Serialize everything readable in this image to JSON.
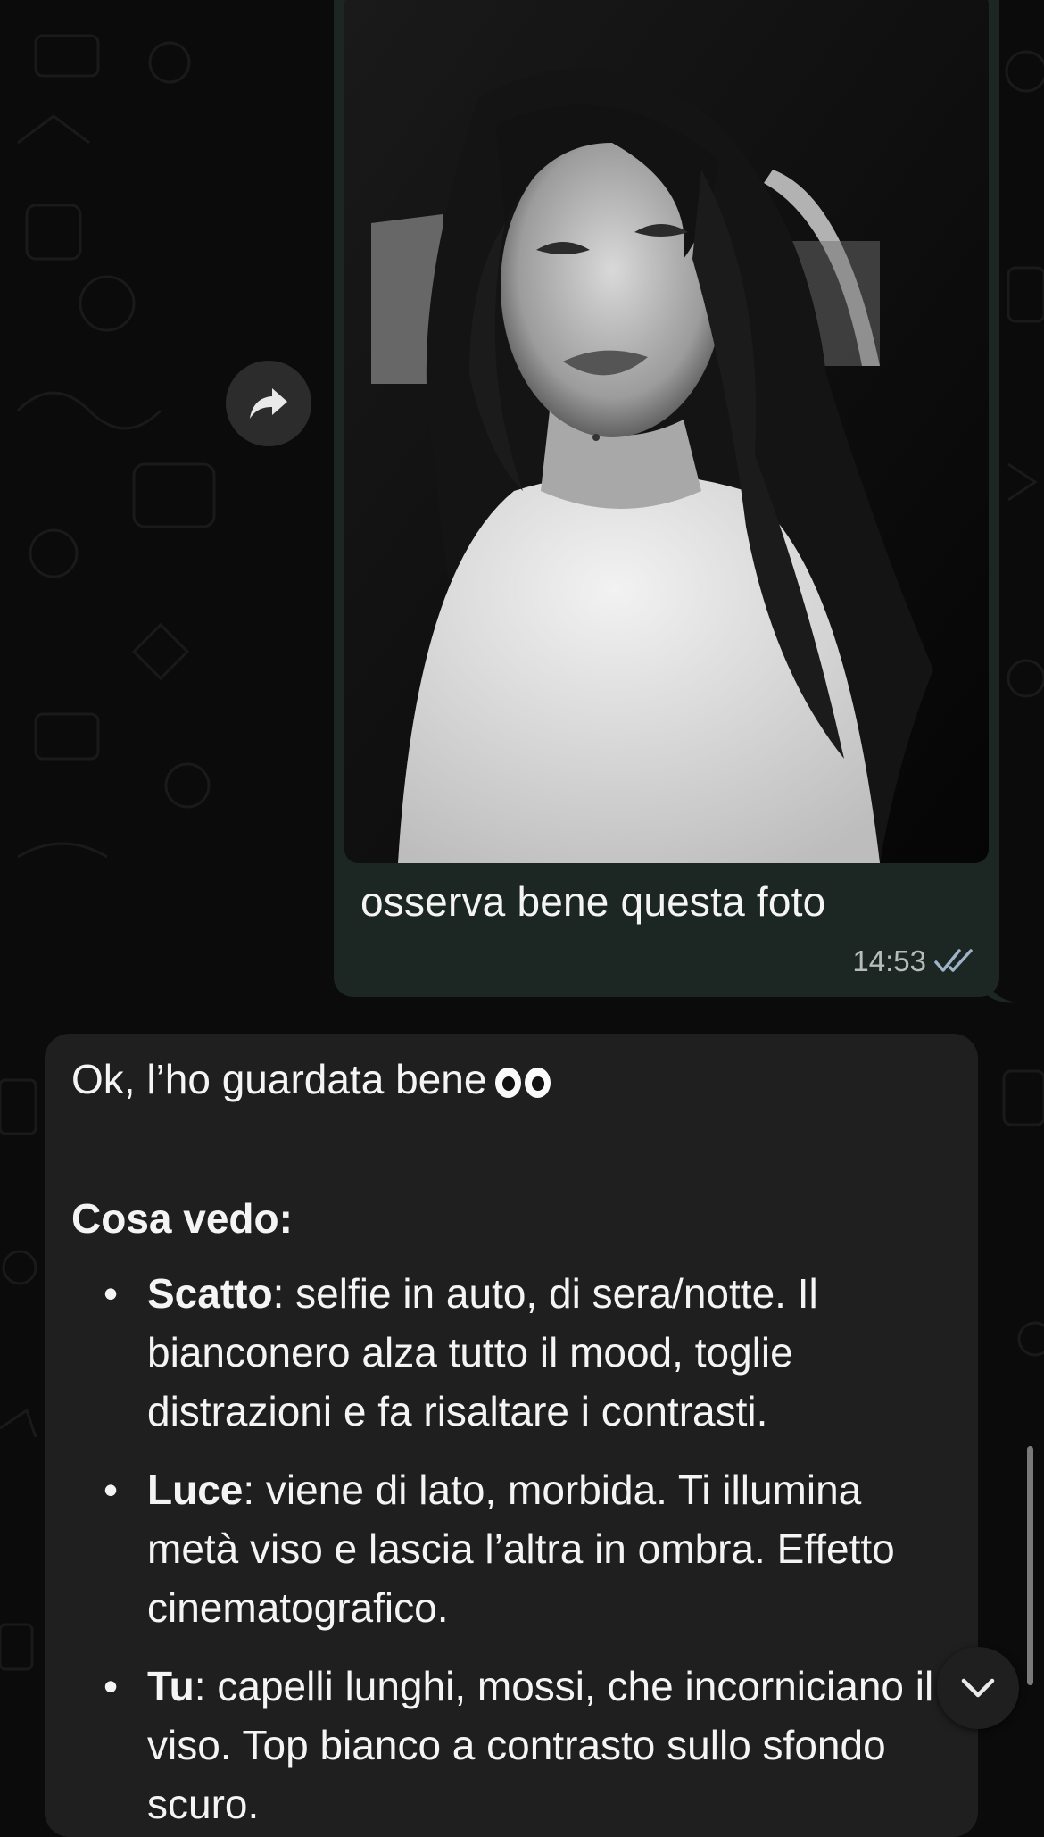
{
  "outgoing_message": {
    "caption": "osserva bene questa foto",
    "time": "14:53",
    "status_icon": "double-check-icon"
  },
  "incoming_message": {
    "greeting": "Ok, l’ho guardata bene",
    "greeting_emoji": "eyes-emoji",
    "heading": "Cosa vedo:",
    "items": [
      {
        "term": "Scatto",
        "text": ": selfie in auto, di sera/notte. Il bianconero alza tutto il mood, toglie distrazioni e fa risaltare i contrasti."
      },
      {
        "term": "Luce",
        "text": ": viene di lato, morbida. Ti illumina metà viso e lascia l’altra in ombra. Effetto cinematografico."
      },
      {
        "term": "Tu",
        "text": ": capelli lunghi, mossi, che incorniciano il viso. Top bianco a contrasto sullo sfondo scuro."
      }
    ]
  },
  "controls": {
    "forward_icon": "forward-arrow-icon",
    "scroll_down_icon": "chevron-down-icon"
  },
  "colors": {
    "background": "#0b0b0b",
    "outgoing_bubble": "#1c2723",
    "incoming_bubble": "#1f1f1f",
    "read_ticks": "#9fb3c8"
  }
}
